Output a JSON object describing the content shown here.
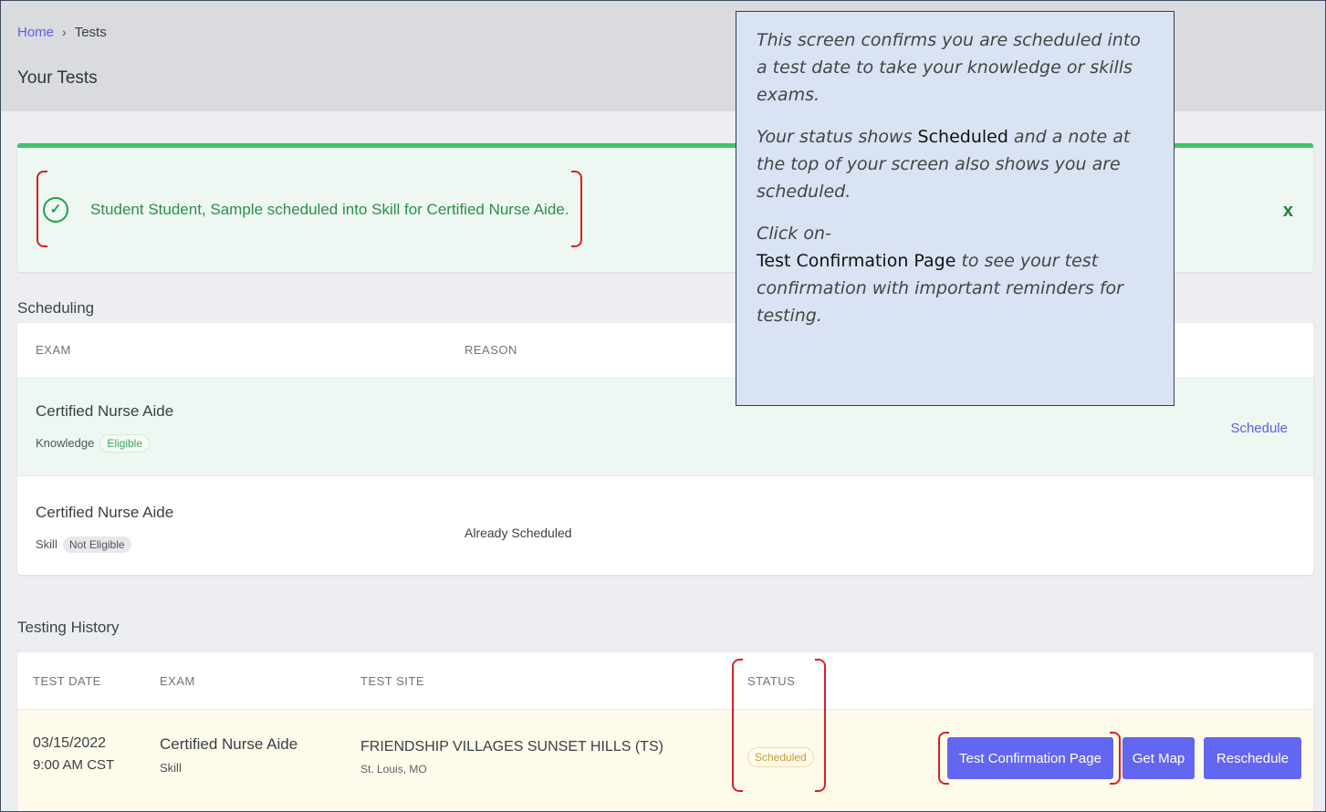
{
  "breadcrumb": {
    "home": "Home",
    "separator": "›",
    "current": "Tests"
  },
  "page_title": "Your Tests",
  "alert": {
    "message": "Student Student, Sample scheduled into Skill for Certified Nurse Aide.",
    "close": "x"
  },
  "scheduling": {
    "label": "Scheduling",
    "columns": [
      "EXAM",
      "REASON"
    ],
    "rows": [
      {
        "exam": "Certified Nurse Aide",
        "type": "Knowledge",
        "eligibility": "Eligible",
        "reason": "",
        "action": "Schedule"
      },
      {
        "exam": "Certified Nurse Aide",
        "type": "Skill",
        "eligibility": "Not Eligible",
        "reason": "Already Scheduled",
        "action": ""
      }
    ]
  },
  "history": {
    "label": "Testing History",
    "columns": [
      "TEST DATE",
      "EXAM",
      "TEST SITE",
      "STATUS"
    ],
    "rows": [
      {
        "date": "03/15/2022",
        "time": "9:00 AM CST",
        "exam": "Certified Nurse Aide",
        "type": "Skill",
        "site": "FRIENDSHIP VILLAGES SUNSET HILLS (TS)",
        "location": "St. Louis, MO",
        "status": "Scheduled"
      }
    ],
    "buttons": {
      "confirmation": "Test Confirmation Page",
      "map": "Get Map",
      "reschedule": "Reschedule"
    }
  },
  "callout": {
    "p1": "This screen confirms you are scheduled into a test date to take your knowledge or skills exams.",
    "p2_a": "Your status shows ",
    "p2_b": "Scheduled",
    "p2_c": " and a note at the top of your screen also shows you are scheduled.",
    "p3_a": "Click on-",
    "p3_b": "Test Confirmation Page",
    "p3_c": " to see your test confirmation with important reminders for testing."
  },
  "colors": {
    "accent": "#6366f1",
    "success": "#3cc468",
    "annotation": "#d62027",
    "callout_bg": "#dae3f3"
  }
}
